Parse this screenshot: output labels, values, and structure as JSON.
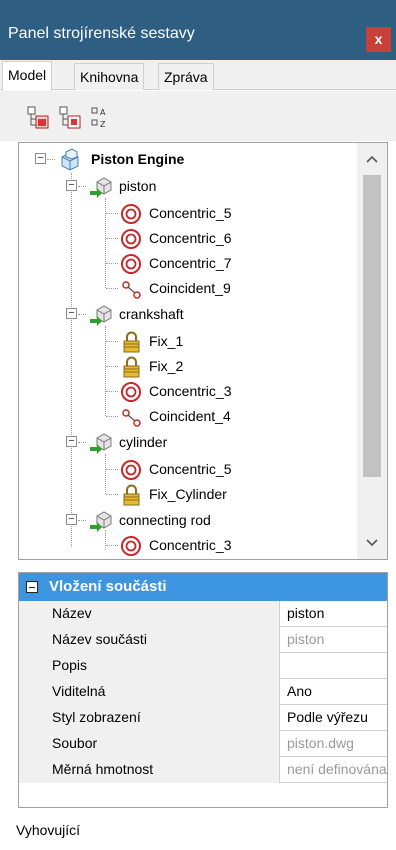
{
  "window": {
    "title": "Panel strojírenské sestavy",
    "close_label": "x",
    "close_color": "#c8403a",
    "titlebar_color": "#2e5f82"
  },
  "tabs": [
    {
      "label": "Model",
      "active": true
    },
    {
      "label": "Knihovna",
      "active": false
    },
    {
      "label": "Zpráva",
      "active": false
    }
  ],
  "toolbar": {
    "buttons": [
      "assembly-view-icon",
      "component-view-icon",
      "sort-az-icon"
    ]
  },
  "tree": {
    "root": {
      "label": "Piston Engine",
      "icon": "assembly-icon"
    },
    "components": [
      {
        "label": "piston",
        "icon": "component-icon",
        "constraints": [
          {
            "label": "Concentric_5",
            "icon": "concentric-icon"
          },
          {
            "label": "Concentric_6",
            "icon": "concentric-icon"
          },
          {
            "label": "Concentric_7",
            "icon": "concentric-icon"
          },
          {
            "label": "Coincident_9",
            "icon": "coincident-icon"
          }
        ]
      },
      {
        "label": "crankshaft",
        "icon": "component-icon",
        "constraints": [
          {
            "label": "Fix_1",
            "icon": "fix-lock-icon"
          },
          {
            "label": "Fix_2",
            "icon": "fix-lock-icon"
          },
          {
            "label": "Concentric_3",
            "icon": "concentric-icon"
          },
          {
            "label": "Coincident_4",
            "icon": "coincident-icon"
          }
        ]
      },
      {
        "label": "cylinder",
        "icon": "component-icon",
        "constraints": [
          {
            "label": "Concentric_5",
            "icon": "concentric-icon"
          },
          {
            "label": "Fix_Cylinder",
            "icon": "fix-lock-icon"
          }
        ]
      },
      {
        "label": "connecting rod",
        "icon": "component-icon",
        "constraints": [
          {
            "label": "Concentric_3",
            "icon": "concentric-icon"
          }
        ]
      }
    ]
  },
  "properties": {
    "header": "Vložení součásti",
    "header_color": "#3d95e0",
    "rows": [
      {
        "name": "Název",
        "value": "piston",
        "readonly": false
      },
      {
        "name": "Název součásti",
        "value": "piston",
        "readonly": true
      },
      {
        "name": "Popis",
        "value": "",
        "readonly": false
      },
      {
        "name": "Viditelná",
        "value": "Ano",
        "readonly": false
      },
      {
        "name": "Styl zobrazení",
        "value": "Podle výřezu",
        "readonly": false
      },
      {
        "name": "Soubor",
        "value": "piston.dwg",
        "readonly": true
      },
      {
        "name": "Měrná hmotnost",
        "value": "není definována",
        "readonly": true
      }
    ]
  },
  "status": {
    "text": "Vyhovující"
  }
}
